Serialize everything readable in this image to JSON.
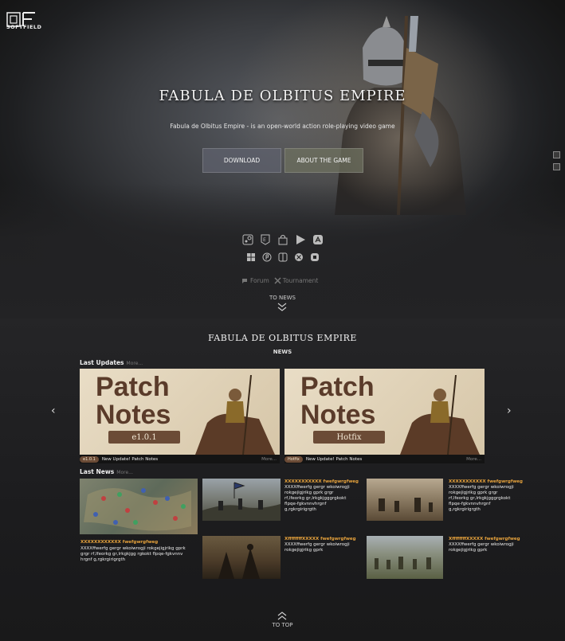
{
  "brand": {
    "name": "SOFTFIELD"
  },
  "hero": {
    "title": "FABULA DE OLBITUS EMPIRE",
    "subtitle": "Fabula de Olbitus Empire - is an open-world action role-playing video game",
    "download_label": "DOWNLOAD",
    "about_label": "ABOUT THE GAME"
  },
  "platforms": {
    "row1": [
      "steam-icon",
      "epic-icon",
      "shopping-bag-icon",
      "play-store-icon",
      "app-store-icon"
    ],
    "row2": [
      "windows-icon",
      "playstation-icon",
      "nintendo-switch-icon",
      "xbox-icon",
      "stadia-icon"
    ]
  },
  "links": {
    "forum": "Forum",
    "tournament": "Tournament"
  },
  "to_news": "TO NEWS",
  "section": {
    "title": "FABULA DE OLBITUS EMPIRE",
    "subtitle": "NEWS"
  },
  "last_updates": {
    "label": "Last Updates",
    "more": "More...",
    "cards": [
      {
        "headline": "Patch\nNotes",
        "version": "e1.0.1",
        "tag": "e1.0.1",
        "caption": "New Update! Patch Notes",
        "more": "More..."
      },
      {
        "headline": "Patch\nNotes",
        "version": "Hotfix",
        "tag": "Hotfix",
        "caption": "New Update! Patch Notes",
        "more": "More..."
      }
    ]
  },
  "last_news": {
    "label": "Last News",
    "more": "More...",
    "featured": {
      "title": "XXXXXXXXXXXX fwefgwrgfweg",
      "text": "XXXXffwerfg gergr wkoiwrogji rokgejigjrikg gprk grgr rf,lfeorkg gr,lrkgkjgg rgkokt flpqe-fgkvnnv hrgnf g,rgkrgirigrgth"
    },
    "items": [
      {
        "title": "XXXXXXXXXXX fwefgwrgfweg",
        "text": "XXXXffwerfg gergr wkoiwrogji rokgejigjrikg gprk grgr rf,lfeorkg gr,lrkgkjgggrgkokt flpqe-fgkvnnvhrgnf g,rgkrgirigrgth"
      },
      {
        "title": "XXXXXXXXXXX fwefgwrgfweg",
        "text": "XXXXffwerfg gergr wkoiwrogji rokgejigjrikg gprk grgr rf,lfeorkg gr,lrkgkjgggrgkokt flpqe-fgkvnnvhrgnf g,rgkrgirigrgth"
      },
      {
        "title": "XffffffffXXXXX fwefgwrgfweg",
        "text": "XXXXffwerfg gergr wkoiwrogji rokgejigjrikg gprk"
      },
      {
        "title": "XffffffffXXXXX fwefgwrgfweg",
        "text": "XXXXffwerfg gergr wkoiwrogji rokgejigjrikg gprk"
      }
    ]
  },
  "to_top": "TO TOP"
}
